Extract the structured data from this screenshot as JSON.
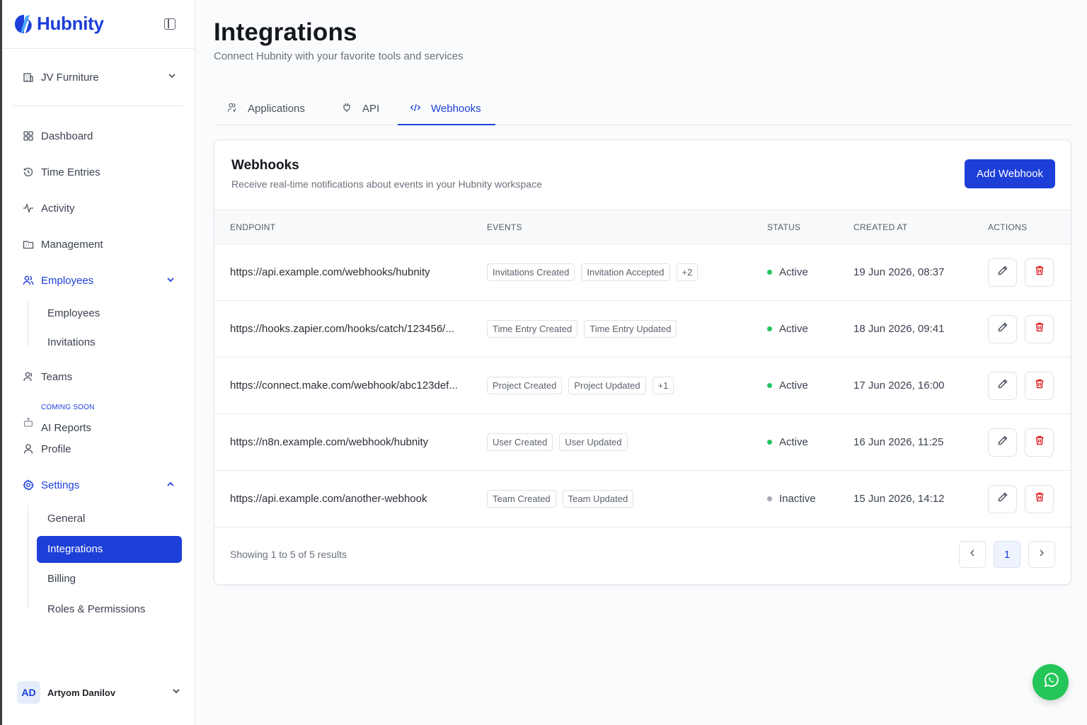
{
  "app": {
    "name": "Hubnity",
    "brand_color": "#1d3fd8"
  },
  "sidebar": {
    "org": "JV Furniture",
    "items": [
      {
        "label": "Dashboard",
        "icon": "dashboard-icon"
      },
      {
        "label": "Time Entries",
        "icon": "history-icon"
      },
      {
        "label": "Activity",
        "icon": "activity-icon"
      },
      {
        "label": "Management",
        "icon": "folder-icon"
      },
      {
        "label": "Employees",
        "icon": "users-icon",
        "expanded": true
      },
      {
        "label": "Teams",
        "icon": "team-icon"
      },
      {
        "label": "AI Reports",
        "icon": "bot-icon",
        "tag": "COMING SOON"
      },
      {
        "label": "Profile",
        "icon": "user-icon"
      },
      {
        "label": "Settings",
        "icon": "gear-icon",
        "expanded": true
      }
    ],
    "employees_sub": [
      "Employees",
      "Invitations"
    ],
    "settings_sub": [
      "General",
      "Integrations",
      "Billing",
      "Roles & Permissions"
    ],
    "active_sub": "Integrations",
    "user": {
      "initials": "AD",
      "name": "Artyom Danilov"
    }
  },
  "page": {
    "title": "Integrations",
    "subtitle": "Connect Hubnity with your favorite tools and services"
  },
  "tabs": [
    {
      "label": "Applications",
      "icon": "apps-icon"
    },
    {
      "label": "API",
      "icon": "plug-icon"
    },
    {
      "label": "Webhooks",
      "icon": "code-icon",
      "active": true
    }
  ],
  "webhooks": {
    "title": "Webhooks",
    "subtitle": "Receive real-time notifications about events in your Hubnity workspace",
    "add_label": "Add Webhook",
    "columns": [
      "ENDPOINT",
      "EVENTS",
      "STATUS",
      "CREATED AT",
      "ACTIONS"
    ],
    "rows": [
      {
        "endpoint": "https://api.example.com/webhooks/hubnity",
        "events": [
          "Invitations Created",
          "Invitation Accepted",
          "+2"
        ],
        "status": "Active",
        "created": "19 Jun 2026, 08:37"
      },
      {
        "endpoint": "https://hooks.zapier.com/hooks/catch/123456/...",
        "events": [
          "Time Entry Created",
          "Time Entry Updated"
        ],
        "status": "Active",
        "created": "18 Jun 2026, 09:41"
      },
      {
        "endpoint": "https://connect.make.com/webhook/abc123def...",
        "events": [
          "Project Created",
          "Project Updated",
          "+1"
        ],
        "status": "Active",
        "created": "17 Jun 2026, 16:00"
      },
      {
        "endpoint": "https://n8n.example.com/webhook/hubnity",
        "events": [
          "User Created",
          "User Updated"
        ],
        "status": "Active",
        "created": "16 Jun 2026, 11:25"
      },
      {
        "endpoint": "https://api.example.com/another-webhook",
        "events": [
          "Team Created",
          "Team Updated"
        ],
        "status": "Inactive",
        "created": "15 Jun 2026, 14:12"
      }
    ],
    "status_colors": {
      "Active": "#22c55e",
      "Inactive": "#a3a8b0"
    },
    "showing": "Showing 1 to 5 of 5 results",
    "page": "1"
  }
}
